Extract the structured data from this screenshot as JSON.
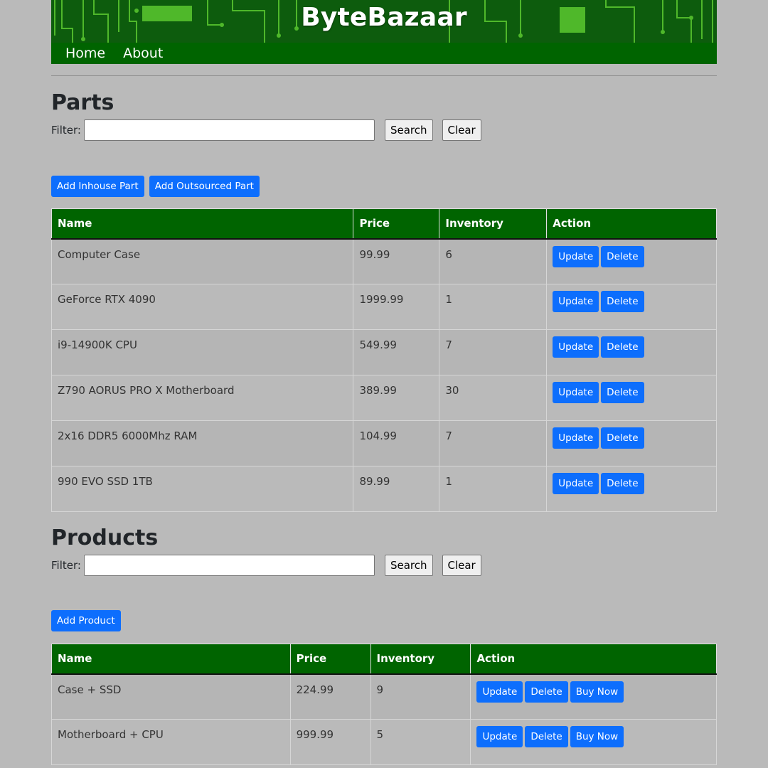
{
  "site": {
    "title": "ByteBazaar",
    "nav": [
      "Home",
      "About"
    ]
  },
  "parts": {
    "heading": "Parts",
    "filter_label": "Filter:",
    "filter_value": "",
    "search_label": "Search",
    "clear_label": "Clear",
    "add_inhouse_label": "Add Inhouse Part",
    "add_outsourced_label": "Add Outsourced Part",
    "columns": [
      "Name",
      "Price",
      "Inventory",
      "Action"
    ],
    "rows": [
      {
        "name": "Computer Case",
        "price": "99.99",
        "inventory": "6"
      },
      {
        "name": "GeForce RTX 4090",
        "price": "1999.99",
        "inventory": "1"
      },
      {
        "name": "i9-14900K CPU",
        "price": "549.99",
        "inventory": "7"
      },
      {
        "name": "Z790 AORUS PRO X Motherboard",
        "price": "389.99",
        "inventory": "30"
      },
      {
        "name": "2x16 DDR5 6000Mhz RAM",
        "price": "104.99",
        "inventory": "7"
      },
      {
        "name": "990 EVO SSD 1TB",
        "price": "89.99",
        "inventory": "1"
      }
    ],
    "update_label": "Update",
    "delete_label": "Delete"
  },
  "products": {
    "heading": "Products",
    "filter_label": "Filter:",
    "filter_value": "",
    "search_label": "Search",
    "clear_label": "Clear",
    "add_label": "Add Product",
    "columns": [
      "Name",
      "Price",
      "Inventory",
      "Action"
    ],
    "rows": [
      {
        "name": "Case + SSD",
        "price": "224.99",
        "inventory": "9"
      },
      {
        "name": "Motherboard + CPU",
        "price": "999.99",
        "inventory": "5"
      }
    ],
    "update_label": "Update",
    "delete_label": "Delete",
    "buy_label": "Buy Now"
  },
  "colors": {
    "header_green": "#006400",
    "button_blue": "#0d6efd",
    "page_bg": "#bababa"
  },
  "icons": {
    "banner": "circuit-board-pattern"
  }
}
